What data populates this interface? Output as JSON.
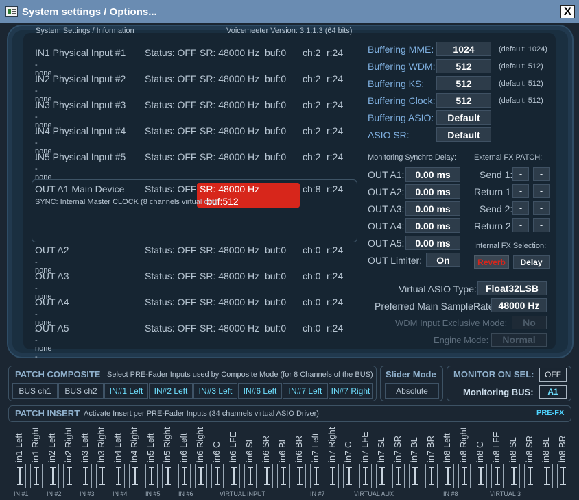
{
  "window": {
    "title": "System settings / Options...",
    "close": "X"
  },
  "info": {
    "header": "System Settings / Information",
    "version": "Voicemeeter Version: 3.1.1.3 (64 bits)"
  },
  "devices": [
    {
      "name": "IN1 Physical Input #1",
      "sub": "- none -",
      "status": "Status: OFF",
      "sr": "SR: 48000 Hz",
      "buf": "buf:0",
      "ch": "ch:2",
      "r": "r:24"
    },
    {
      "name": "IN2 Physical Input #2",
      "sub": "- none -",
      "status": "Status: OFF",
      "sr": "SR: 48000 Hz",
      "buf": "buf:0",
      "ch": "ch:2",
      "r": "r:24"
    },
    {
      "name": "IN3 Physical Input #3",
      "sub": "- none -",
      "status": "Status: OFF",
      "sr": "SR: 48000 Hz",
      "buf": "buf:0",
      "ch": "ch:2",
      "r": "r:24"
    },
    {
      "name": "IN4 Physical Input #4",
      "sub": "- none -",
      "status": "Status: OFF",
      "sr": "SR: 48000 Hz",
      "buf": "buf:0",
      "ch": "ch:2",
      "r": "r:24"
    },
    {
      "name": "IN5 Physical Input #5",
      "sub": "- none -",
      "status": "Status: OFF",
      "sr": "SR: 48000 Hz",
      "buf": "buf:0",
      "ch": "ch:2",
      "r": "r:24"
    }
  ],
  "main_device": {
    "name": "OUT A1 Main Device",
    "status": "Status: OFF",
    "sr": "SR: 48000 Hz",
    "buf": "buf:512",
    "ch": "ch:8",
    "r": "r:24",
    "sync": "SYNC: Internal Master CLOCK (8 channels virtual out)"
  },
  "outputs": [
    {
      "name": "OUT A2",
      "sub": "- none -",
      "status": "Status: OFF",
      "sr": "SR: 48000 Hz",
      "buf": "buf:0",
      "ch": "ch:0",
      "r": "r:24"
    },
    {
      "name": "OUT A3",
      "sub": "- none -",
      "status": "Status: OFF",
      "sr": "SR: 48000 Hz",
      "buf": "buf:0",
      "ch": "ch:0",
      "r": "r:24"
    },
    {
      "name": "OUT A4",
      "sub": "- none -",
      "status": "Status: OFF",
      "sr": "SR: 48000 Hz",
      "buf": "buf:0",
      "ch": "ch:0",
      "r": "r:24"
    },
    {
      "name": "OUT A5",
      "sub": "- none -",
      "status": "Status: OFF",
      "sr": "SR: 48000 Hz",
      "buf": "buf:0",
      "ch": "ch:0",
      "r": "r:24"
    }
  ],
  "buffering": [
    {
      "label": "Buffering MME:",
      "value": "1024",
      "default": "(default: 1024)"
    },
    {
      "label": "Buffering WDM:",
      "value": "512",
      "default": "(default: 512)"
    },
    {
      "label": "Buffering KS:",
      "value": "512",
      "default": "(default: 512)"
    },
    {
      "label": "Buffering Clock:",
      "value": "512",
      "default": "(default: 512)"
    },
    {
      "label": "Buffering ASIO:",
      "value": "Default",
      "default": ""
    },
    {
      "label": "ASIO SR:",
      "value": "Default",
      "default": ""
    }
  ],
  "monitoring": {
    "title": "Monitoring Synchro Delay:",
    "rows": [
      {
        "label": "OUT A1:",
        "value": "0.00 ms"
      },
      {
        "label": "OUT A2:",
        "value": "0.00 ms"
      },
      {
        "label": "OUT A3:",
        "value": "0.00 ms"
      },
      {
        "label": "OUT A4:",
        "value": "0.00 ms"
      },
      {
        "label": "OUT A5:",
        "value": "0.00 ms"
      }
    ],
    "limiter_label": "OUT Limiter:",
    "limiter_value": "On"
  },
  "fx": {
    "title": "External FX PATCH:",
    "rows": [
      {
        "label": "Send 1:",
        "a": "-",
        "b": "-"
      },
      {
        "label": "Return 1:",
        "a": "-",
        "b": "-"
      },
      {
        "label": "Send 2:",
        "a": "-",
        "b": "-"
      },
      {
        "label": "Return 2:",
        "a": "-",
        "b": "-"
      }
    ],
    "internal_title": "Internal FX Selection:",
    "reverb": "Reverb",
    "delay": "Delay"
  },
  "asio": {
    "type_label": "Virtual ASIO Type:",
    "type_value": "Float32LSB",
    "rate_label": "Preferred Main SampleRate:",
    "rate_value": "48000 Hz",
    "wdm_label": "WDM Input Exclusive Mode:",
    "wdm_value": "No",
    "engine_label": "Engine Mode:",
    "engine_value": "Normal"
  },
  "composite": {
    "title": "PATCH COMPOSITE",
    "desc": "Select PRE-Fader Inputs used by Composite Mode (for 8 Channels of the BUS)",
    "buttons": [
      "BUS ch1",
      "BUS ch2",
      "IN#1 Left",
      "IN#2 Left",
      "IN#3 Left",
      "IN#6 Left",
      "IN#7 Left",
      "IN#7 Right"
    ]
  },
  "slider": {
    "title": "Slider Mode",
    "value": "Absolute"
  },
  "monitor": {
    "title": "MONITOR ON SEL:",
    "value": "OFF",
    "bus_label": "Monitoring BUS:",
    "bus_value": "A1"
  },
  "insert": {
    "title": "PATCH INSERT",
    "desc": "Activate Insert per PRE-Fader Inputs (34 channels virtual ASIO Driver)",
    "prefx": "PRE-FX",
    "channels": [
      "in1 Left",
      "in1 Right",
      "in2 Left",
      "in2 Right",
      "in3 Left",
      "in3 Right",
      "in4 Left",
      "in4 Right",
      "in5 Left",
      "in5 Right",
      "in6 Left",
      "in6 Right",
      "in6 C",
      "in6 LFE",
      "in6 SL",
      "in6 SR",
      "in6 BL",
      "in6 BR",
      "in7 Left",
      "in7 Right",
      "in7 C",
      "in7 LFE",
      "in7 SL",
      "in7 SR",
      "in7 BL",
      "in7 BR",
      "in8 Left",
      "in8 Right",
      "in8 C",
      "in8 LFE",
      "in8 SL",
      "in8 SR",
      "in8 BL",
      "in8 BR"
    ],
    "groups": [
      "IN #1",
      "IN #2",
      "IN #3",
      "IN #4",
      "IN #5",
      "IN #6",
      "VIRTUAL INPUT",
      "IN #7",
      "VIRTUAL AUX",
      "IN #8",
      "VIRTUAL 3"
    ]
  }
}
